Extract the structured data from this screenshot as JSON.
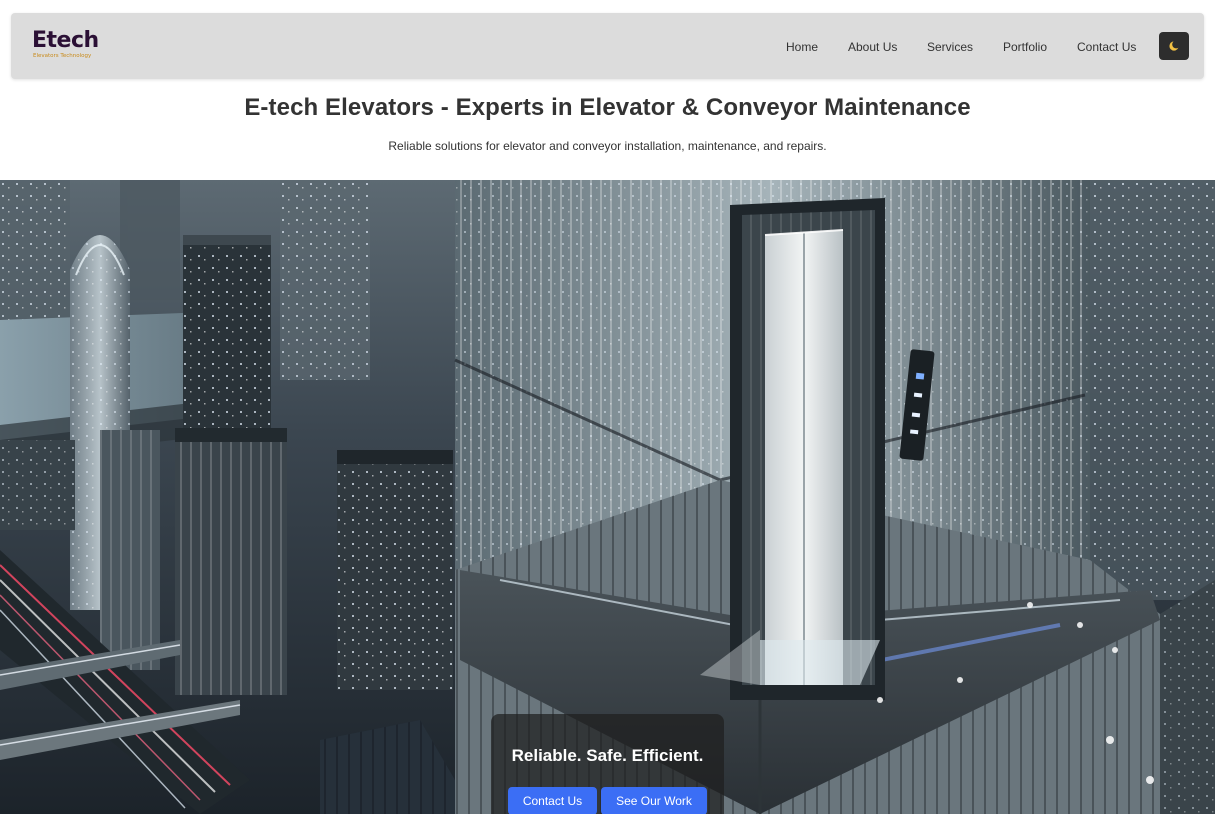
{
  "brand": {
    "logo_text": "Etech",
    "logo_tagline": "Elevators Technology",
    "logo_color": "#2b1035",
    "tagline_color": "#c88a1a"
  },
  "nav": {
    "items": [
      {
        "label": "Home"
      },
      {
        "label": "About Us"
      },
      {
        "label": "Services"
      },
      {
        "label": "Portfolio"
      },
      {
        "label": "Contact Us"
      }
    ],
    "theme_toggle_icon": "moon-icon"
  },
  "hero": {
    "title": "E-tech Elevators - Experts in Elevator & Conveyor Maintenance",
    "subtitle": "Reliable solutions for elevator and conveyor installation, maintenance, and repairs."
  },
  "banner": {
    "image": "night-city-glass-elevator-illustration",
    "cta_title": "Reliable. Safe. Efficient.",
    "buttons": {
      "contact": "Contact Us",
      "work": "See Our Work"
    }
  },
  "colors": {
    "navbar_bg": "#dcdcdc",
    "button_blue": "#3b6ef5",
    "overlay": "rgba(30,30,30,0.72)"
  }
}
